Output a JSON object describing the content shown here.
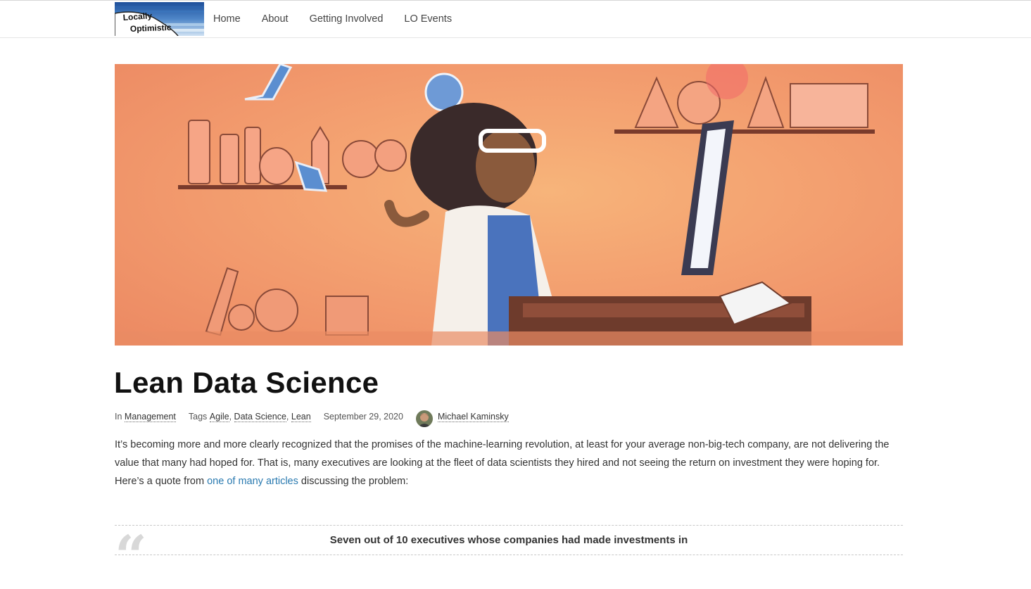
{
  "site": {
    "logo_line1": "Locally",
    "logo_line2": "Optimistic",
    "nav": [
      "Home",
      "About",
      "Getting Involved",
      "LO Events"
    ]
  },
  "article": {
    "title": "Lean Data Science",
    "meta": {
      "in_label": "In",
      "category": "Management",
      "tags_label": "Tags",
      "tags": [
        "Agile",
        "Data Science",
        "Lean"
      ],
      "tag_sep": ",",
      "date": "September 29, 2020",
      "author": "Michael Kaminsky"
    },
    "intro_before": "It’s becoming more and more clearly recognized that the promises of the machine-learning revolution, at least for your average non-big-tech company, are not delivering the value that many had hoped for. That is, many executives are looking at the fleet of data scientists they hired and not seeing the return on investment they were hoping for.  Here’s a quote from ",
    "intro_link": "one of many articles",
    "intro_after": " discussing the problem:",
    "quote_mark": "“",
    "quote_text": "Seven out of 10 executives whose companies had made investments in"
  },
  "colors": {
    "link": "#2a7ab0",
    "hero_bg": "#f2a070"
  }
}
